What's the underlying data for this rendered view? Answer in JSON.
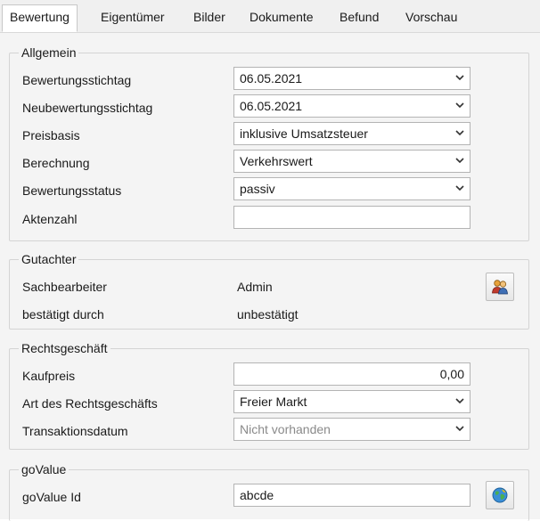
{
  "tabs": [
    {
      "label": "Bewertung",
      "active": true
    },
    {
      "label": "Eigentümer"
    },
    {
      "label": "Bilder"
    },
    {
      "label": "Dokumente"
    },
    {
      "label": "Befund"
    },
    {
      "label": "Vorschau"
    }
  ],
  "allgemein": {
    "title": "Allgemein",
    "bewertungsstichtag": {
      "label": "Bewertungsstichtag",
      "value": "06.05.2021"
    },
    "neubewertungsstichtag": {
      "label": "Neubewertungsstichtag",
      "value": "06.05.2021"
    },
    "preisbasis": {
      "label": "Preisbasis",
      "value": "inklusive Umsatzsteuer"
    },
    "berechnung": {
      "label": "Berechnung",
      "value": "Verkehrswert"
    },
    "bewertungsstatus": {
      "label": "Bewertungsstatus",
      "value": "passiv"
    },
    "aktenzahl": {
      "label": "Aktenzahl",
      "value": ""
    }
  },
  "gutachter": {
    "title": "Gutachter",
    "sachbearbeiter": {
      "label": "Sachbearbeiter",
      "value": "Admin",
      "icon": "users-icon"
    },
    "bestaetigt": {
      "label": "bestätigt durch",
      "value": "unbestätigt"
    }
  },
  "rechtsgeschaeft": {
    "title": "Rechtsgeschäft",
    "kaufpreis": {
      "label": "Kaufpreis",
      "value": "0,00"
    },
    "art": {
      "label": "Art des Rechtsgeschäfts",
      "value": "Freier Markt"
    },
    "transaktionsdatum": {
      "label": "Transaktionsdatum",
      "value": "Nicht vorhanden"
    }
  },
  "govalue": {
    "title": "goValue",
    "id": {
      "label": "goValue Id",
      "value": "abcde",
      "icon": "globe-icon"
    }
  },
  "colors": {
    "accent_border": "#b4b4b4",
    "panel_bg": "#f4f4f4",
    "disabled_text": "#8a8a8a"
  }
}
